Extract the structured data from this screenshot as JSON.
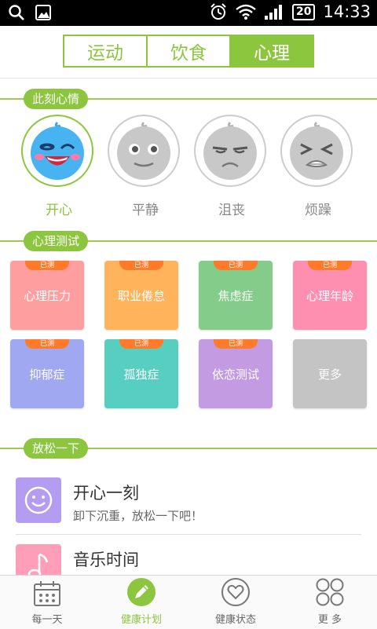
{
  "status": {
    "time": "14:33",
    "battery": "20"
  },
  "tabs": [
    {
      "label": "运动",
      "active": false
    },
    {
      "label": "饮食",
      "active": false
    },
    {
      "label": "心理",
      "active": true
    }
  ],
  "mood_section": {
    "title": "此刻心情",
    "moods": [
      {
        "label": "开心",
        "icon": "happy-face-icon",
        "active": true
      },
      {
        "label": "平静",
        "icon": "calm-face-icon",
        "active": false
      },
      {
        "label": "沮丧",
        "icon": "frustrated-face-icon",
        "active": false
      },
      {
        "label": "烦躁",
        "icon": "irritable-face-icon",
        "active": false
      }
    ]
  },
  "test_section": {
    "title": "心理测试",
    "tiles": [
      {
        "label": "心理压力",
        "badge": "已测",
        "color": "#ff9e9e"
      },
      {
        "label": "职业倦怠",
        "badge": "已测",
        "color": "#ffb35b"
      },
      {
        "label": "焦虑症",
        "badge": "已测",
        "color": "#83cc89"
      },
      {
        "label": "心理年龄",
        "badge": "已测",
        "color": "#ff8fb0"
      },
      {
        "label": "抑郁症",
        "badge": "已测",
        "color": "#9fa8f0"
      },
      {
        "label": "孤独症",
        "badge": "已测",
        "color": "#56cfc0"
      },
      {
        "label": "依恋测试",
        "badge": "已测",
        "color": "#c39be2"
      },
      {
        "label": "更多",
        "badge": "",
        "color": "#c4c4c4"
      }
    ]
  },
  "relax_section": {
    "title": "放松一下",
    "items": [
      {
        "title": "开心一刻",
        "subtitle": "卸下沉重，放松一下吧！",
        "icon": "smile-icon",
        "color": "#b49cf0"
      },
      {
        "title": "音乐时间",
        "subtitle": "",
        "icon": "music-note-icon",
        "color": "#ff9eb8"
      }
    ]
  },
  "bottom_nav": [
    {
      "label": "每一天",
      "icon": "calendar-icon",
      "active": false
    },
    {
      "label": "健康计划",
      "icon": "pencil-icon",
      "active": true
    },
    {
      "label": "健康状态",
      "icon": "heart-icon",
      "active": false
    },
    {
      "label": "更 多",
      "icon": "grid-icon",
      "active": false
    }
  ],
  "colors": {
    "accent": "#8cc63f",
    "badge": "#ff7b2a"
  }
}
